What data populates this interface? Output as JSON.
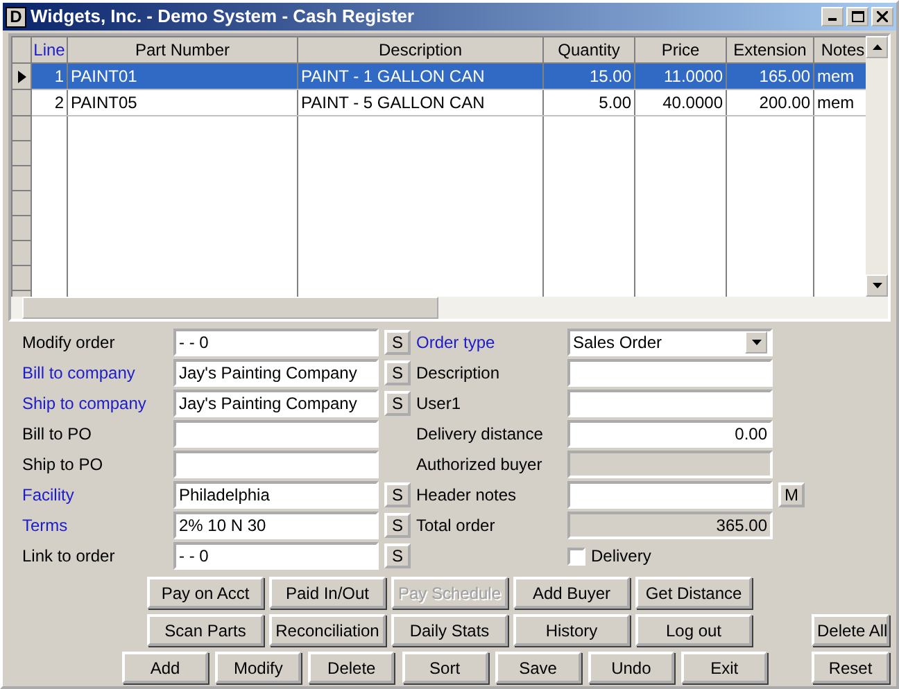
{
  "window": {
    "title": "Widgets, Inc. - Demo System - Cash Register",
    "app_icon": "D"
  },
  "grid": {
    "columns": [
      {
        "label": "Line",
        "linked": true
      },
      {
        "label": "Part Number",
        "linked": false
      },
      {
        "label": "Description",
        "linked": false
      },
      {
        "label": "Quantity",
        "linked": false
      },
      {
        "label": "Price",
        "linked": false
      },
      {
        "label": "Extension",
        "linked": false
      },
      {
        "label": "Notes",
        "linked": false
      }
    ],
    "rows": [
      {
        "selected": true,
        "cells": [
          "1",
          "PAINT01",
          "PAINT - 1 GALLON CAN",
          "15.00",
          "11.0000",
          "165.00",
          "mem"
        ]
      },
      {
        "selected": false,
        "cells": [
          "2",
          "PAINT05",
          "PAINT - 5 GALLON CAN",
          "5.00",
          "40.0000",
          "200.00",
          "mem"
        ]
      }
    ]
  },
  "left_fields": [
    {
      "label": "Modify order",
      "linked": false,
      "value": "-    - 0",
      "button": "S"
    },
    {
      "label": "Bill to company",
      "linked": true,
      "value": "Jay's Painting Company",
      "button": "S"
    },
    {
      "label": "Ship to company",
      "linked": true,
      "value": "Jay's Painting Company",
      "button": "S"
    },
    {
      "label": "Bill to PO",
      "linked": false
    },
    {
      "label": "Ship to PO",
      "linked": false
    },
    {
      "label": "Facility",
      "linked": true,
      "value": "Philadelphia",
      "button": "S"
    },
    {
      "label": "Terms",
      "linked": true,
      "value": "2% 10 N 30",
      "button": "S"
    },
    {
      "label": "Link to order",
      "linked": false,
      "value": "-    - 0",
      "button": "S"
    }
  ],
  "right_fields": [
    {
      "label": "Order type",
      "linked": true,
      "kind": "dropdown",
      "value": "Sales Order",
      "disabled": false
    },
    {
      "label": "Description",
      "linked": false,
      "kind": "text",
      "disabled": false
    },
    {
      "label": "User1",
      "linked": false,
      "kind": "text",
      "disabled": false
    },
    {
      "label": "Delivery distance",
      "linked": false,
      "kind": "number",
      "value": "0.00",
      "disabled": false
    },
    {
      "label": "Authorized buyer",
      "linked": false,
      "kind": "text",
      "disabled": true
    },
    {
      "label": "Header notes",
      "linked": false,
      "kind": "text",
      "disabled": false,
      "button": "M"
    },
    {
      "label": "Total order",
      "linked": false,
      "kind": "number",
      "value": "365.00",
      "disabled": true
    }
  ],
  "delivery": {
    "label": "Delivery",
    "checked": false
  },
  "button_rows": [
    {
      "buttons": [
        {
          "label": "Pay on Acct",
          "disabled": false
        },
        {
          "label": "Paid In/Out",
          "disabled": false
        },
        {
          "label": "Pay Schedule",
          "disabled": true
        },
        {
          "label": "Add Buyer",
          "disabled": false
        },
        {
          "label": "Get Distance",
          "disabled": false
        }
      ]
    },
    {
      "buttons": [
        {
          "label": "Scan Parts",
          "disabled": false
        },
        {
          "label": "Reconciliation",
          "disabled": false
        },
        {
          "label": "Daily Stats",
          "disabled": false
        },
        {
          "label": "History",
          "disabled": false
        },
        {
          "label": "Log out",
          "disabled": false
        }
      ],
      "side": {
        "label": "Delete All",
        "disabled": false
      }
    },
    {
      "buttons": [
        {
          "label": "Add",
          "disabled": false
        },
        {
          "label": "Modify",
          "disabled": false
        },
        {
          "label": "Delete",
          "disabled": false
        },
        {
          "label": "Sort",
          "disabled": false
        },
        {
          "label": "Save",
          "disabled": false
        },
        {
          "label": "Undo",
          "disabled": false
        },
        {
          "label": "Exit",
          "disabled": false
        }
      ],
      "side": {
        "label": "Reset",
        "disabled": false
      }
    }
  ]
}
